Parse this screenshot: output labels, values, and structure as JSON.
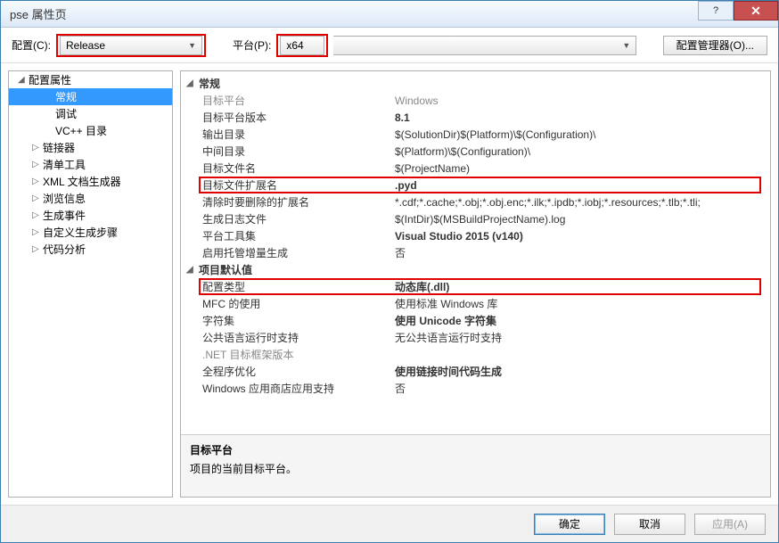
{
  "window": {
    "title": "pse 属性页"
  },
  "topbar": {
    "config_label": "配置(C):",
    "config_value": "Release",
    "platform_label": "平台(P):",
    "platform_value": "x64",
    "manager_btn": "配置管理器(O)..."
  },
  "tree": {
    "root": "配置属性",
    "items": [
      {
        "label": "常规",
        "selected": true,
        "expandable": false
      },
      {
        "label": "调试",
        "expandable": false
      },
      {
        "label": "VC++ 目录",
        "expandable": false
      },
      {
        "label": "链接器",
        "expandable": true
      },
      {
        "label": "清单工具",
        "expandable": true
      },
      {
        "label": "XML 文档生成器",
        "expandable": true
      },
      {
        "label": "浏览信息",
        "expandable": true
      },
      {
        "label": "生成事件",
        "expandable": true
      },
      {
        "label": "自定义生成步骤",
        "expandable": true
      },
      {
        "label": "代码分析",
        "expandable": true
      }
    ]
  },
  "grid": {
    "sections": [
      {
        "title": "常规",
        "rows": [
          {
            "label": "目标平台",
            "value": "Windows",
            "disabled": true
          },
          {
            "label": "目标平台版本",
            "value": "8.1",
            "bold": true
          },
          {
            "label": "输出目录",
            "value": "$(SolutionDir)$(Platform)\\$(Configuration)\\"
          },
          {
            "label": "中间目录",
            "value": "$(Platform)\\$(Configuration)\\"
          },
          {
            "label": "目标文件名",
            "value": "$(ProjectName)"
          },
          {
            "label": "目标文件扩展名",
            "value": ".pyd",
            "bold": true,
            "highlight": true
          },
          {
            "label": "清除时要删除的扩展名",
            "value": "*.cdf;*.cache;*.obj;*.obj.enc;*.ilk;*.ipdb;*.iobj;*.resources;*.tlb;*.tli;"
          },
          {
            "label": "生成日志文件",
            "value": "$(IntDir)$(MSBuildProjectName).log"
          },
          {
            "label": "平台工具集",
            "value": "Visual Studio 2015 (v140)",
            "bold": true
          },
          {
            "label": "启用托管增量生成",
            "value": "否"
          }
        ]
      },
      {
        "title": "项目默认值",
        "rows": [
          {
            "label": "配置类型",
            "value": "动态库(.dll)",
            "bold": true,
            "highlight": true
          },
          {
            "label": "MFC 的使用",
            "value": "使用标准 Windows 库"
          },
          {
            "label": "字符集",
            "value": "使用 Unicode 字符集",
            "bold": true
          },
          {
            "label": "公共语言运行时支持",
            "value": "无公共语言运行时支持"
          },
          {
            "label": ".NET 目标框架版本",
            "value": "",
            "disabled": true
          },
          {
            "label": "全程序优化",
            "value": "使用链接时间代码生成",
            "bold": true
          },
          {
            "label": "Windows 应用商店应用支持",
            "value": "否"
          }
        ]
      }
    ]
  },
  "desc": {
    "title": "目标平台",
    "text": "项目的当前目标平台。"
  },
  "footer": {
    "ok": "确定",
    "cancel": "取消",
    "apply": "应用(A)"
  }
}
